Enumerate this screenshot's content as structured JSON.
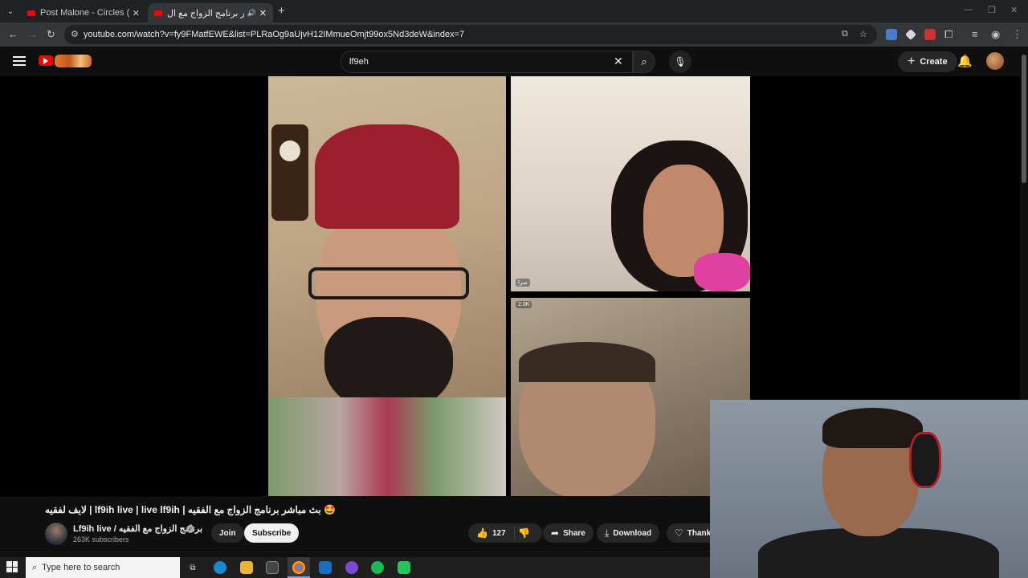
{
  "browser": {
    "tabs": [
      {
        "title": "Post Malone - Circles (Official M",
        "active": false
      },
      {
        "title": "بث مباشر برنامج الزواج مع ال",
        "active": true
      }
    ],
    "url": "youtube.com/watch?v=fy9FMatfEWE&list=PLRaOg9aUjvH12IMmueOmjt99ox5Nd3deW&index=7"
  },
  "youtube": {
    "search": {
      "value": "lf9eh"
    },
    "create_label": "Create"
  },
  "video": {
    "participant_labels": [
      "سرا",
      "2.0K"
    ],
    "title": "لايف لفقيه | lf9ih live | live lf9ih | بث مباشر برنامج الزواج مع الفقيه 🤩",
    "channel": {
      "name": "Lf9ih live / برنامج الزواج مع الفقيه",
      "subscribers": "263K subscribers"
    },
    "join_label": "Join",
    "subscribe_label": "Subscribe",
    "likes": "127",
    "share_label": "Share",
    "download_label": "Download",
    "thanks_label": "Thank"
  },
  "taskbar": {
    "search_placeholder": "Type here to search"
  },
  "colors": {
    "brand_red": "#ff0000",
    "bg": "#0f0f0f",
    "pill_bg": "#272727"
  }
}
